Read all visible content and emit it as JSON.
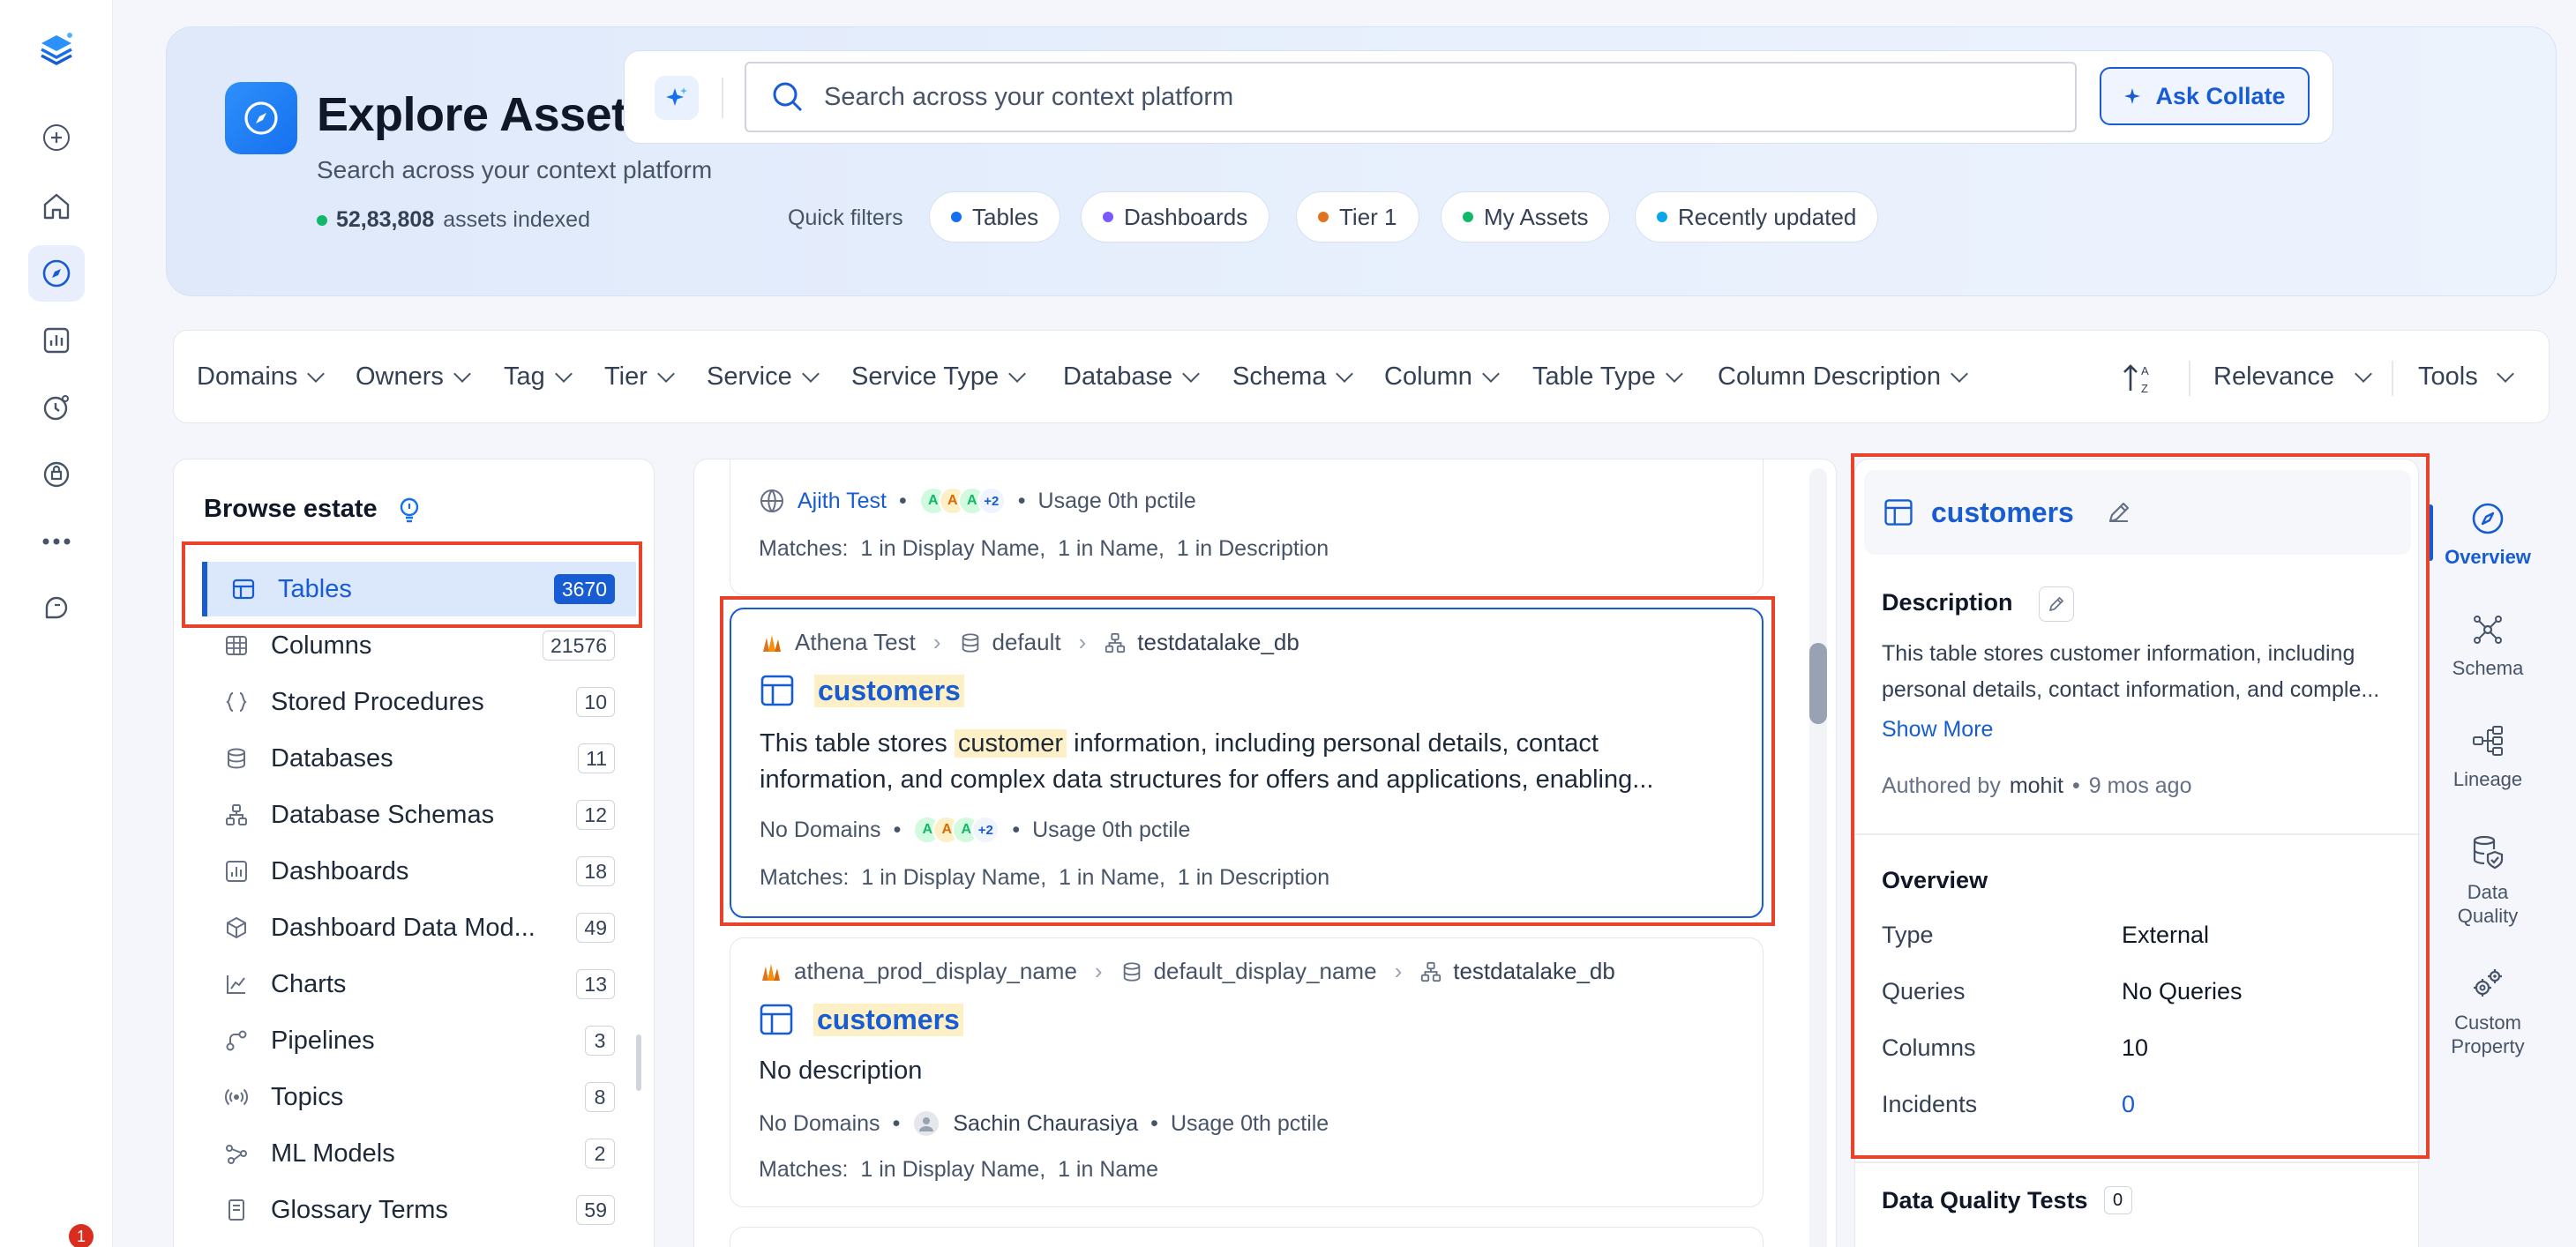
{
  "hero": {
    "title": "Explore Assets",
    "subtitle": "Search across your context platform",
    "asset_count": "52,83,808",
    "asset_suffix": "assets indexed"
  },
  "search": {
    "placeholder": "Search across your context platform",
    "ask_label": "Ask Collate"
  },
  "quick_filters": {
    "label": "Quick filters",
    "chips": [
      {
        "label": "Tables",
        "color": "#1570ef"
      },
      {
        "label": "Dashboards",
        "color": "#7a5af8"
      },
      {
        "label": "Tier 1",
        "color": "#e0731f"
      },
      {
        "label": "My Assets",
        "color": "#12b76a"
      },
      {
        "label": "Recently updated",
        "color": "#0ba5ec"
      }
    ]
  },
  "filters": [
    "Domains",
    "Owners",
    "Tag",
    "Tier",
    "Service",
    "Service Type",
    "Database",
    "Schema",
    "Column",
    "Table Type",
    "Column Description"
  ],
  "sort": {
    "label": "Relevance",
    "tools": "Tools"
  },
  "browse": {
    "title": "Browse estate",
    "items": [
      {
        "label": "Tables",
        "count": "3670"
      },
      {
        "label": "Columns",
        "count": "21576"
      },
      {
        "label": "Stored Procedures",
        "count": "10"
      },
      {
        "label": "Databases",
        "count": "11"
      },
      {
        "label": "Database Schemas",
        "count": "12"
      },
      {
        "label": "Dashboards",
        "count": "18"
      },
      {
        "label": "Dashboard Data Mod...",
        "count": "49"
      },
      {
        "label": "Charts",
        "count": "13"
      },
      {
        "label": "Pipelines",
        "count": "3"
      },
      {
        "label": "Topics",
        "count": "8"
      },
      {
        "label": "ML Models",
        "count": "2"
      },
      {
        "label": "Glossary Terms",
        "count": "59"
      }
    ]
  },
  "results": {
    "card0": {
      "owner": "Ajith Test",
      "avatar_more": "+2",
      "usage": "Usage 0th pctile",
      "matches": [
        "Matches:",
        "1 in Display Name,",
        "1 in Name,",
        "1 in Description"
      ]
    },
    "card1": {
      "service": "Athena Test",
      "database": "default",
      "schema": "testdatalake_db",
      "name": "customers",
      "desc_before": "This table stores ",
      "desc_hl": "customer",
      "desc_after": " information, including personal details, contact information, and complex data structures for offers and applications, enabling...",
      "domains": "No Domains",
      "avatar_more": "+2",
      "usage": "Usage 0th pctile",
      "matches": [
        "Matches:",
        "1 in Display Name,",
        "1 in Name,",
        "1 in Description"
      ]
    },
    "card2": {
      "service": "athena_prod_display_name",
      "database": "default_display_name",
      "schema": "testdatalake_db",
      "name": "customers",
      "desc": "No description",
      "domains": "No Domains",
      "owner": "Sachin Chaurasiya",
      "usage": "Usage 0th pctile",
      "matches": [
        "Matches:",
        "1 in Display Name,",
        "1 in Name"
      ]
    }
  },
  "detail": {
    "title": "customers",
    "description_label": "Description",
    "description": "This table stores customer information, including personal details, contact information, and comple...",
    "show_more": "Show More",
    "authored_prefix": "Authored by",
    "author": "mohit",
    "time": "9 mos ago",
    "overview_label": "Overview",
    "rows": [
      {
        "label": "Type",
        "value": "External"
      },
      {
        "label": "Queries",
        "value": "No Queries"
      },
      {
        "label": "Columns",
        "value": "10"
      },
      {
        "label": "Incidents",
        "value": "0"
      }
    ],
    "dq_label": "Data Quality Tests",
    "dq_count": "0"
  },
  "right_tabs": [
    "Overview",
    "Schema",
    "Lineage",
    "Data Quality",
    "Custom Property"
  ],
  "rail": {
    "notification_count": "1"
  }
}
